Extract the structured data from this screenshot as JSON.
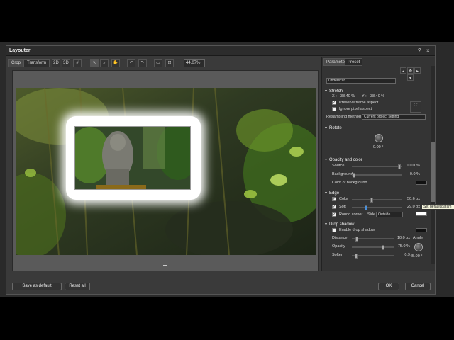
{
  "window": {
    "title": "Layouter",
    "controls": [
      "?",
      "×"
    ]
  },
  "tabs": [
    {
      "label": "Crop"
    },
    {
      "label": "Transform"
    }
  ],
  "toolbar": {
    "buttons": [
      "2D",
      "3D",
      "grid",
      "arrow",
      "zoom",
      "hand",
      "undo",
      "redo",
      "frame",
      "fit"
    ],
    "zoom_value": "44.07%"
  },
  "panel": {
    "tabs": [
      {
        "label": "Parameter"
      },
      {
        "label": "Preset"
      }
    ],
    "scan_select": "Underscan",
    "stretch": {
      "title": "Stretch",
      "x_label": "X :",
      "x_value": "38.40 %",
      "y_label": "Y :",
      "y_value": "38.40 %",
      "preserve_frame": "Preserve frame aspect",
      "ignore_pixel": "Ignore pixel aspect",
      "resampling_label": "Resampling method",
      "resampling_value": "Current project setting"
    },
    "rotate": {
      "title": "Rotate",
      "value": "0.00 °"
    },
    "opacity": {
      "title": "Opacity and color",
      "source_label": "Source",
      "source_value": "100.0%",
      "source_fraction": 1.0,
      "background_label": "Background",
      "background_value": "0.0 %",
      "background_fraction": 0.0,
      "color_bg_label": "Color of background"
    },
    "edge": {
      "title": "Edge",
      "color_label": "Color",
      "color_value": "50.6 px",
      "color_fraction": 0.39,
      "soft_label": "Soft",
      "soft_value": "29.0 px",
      "soft_fraction": 0.26,
      "round_corner": "Round corner",
      "side_label": "Side",
      "side_value": "Outside"
    },
    "drop_shadow": {
      "title": "Drop shadow",
      "enable": "Enable drop shadow",
      "distance_label": "Distance",
      "distance_value": "10.0 px",
      "distance_fraction": 0.08,
      "opacity_label": "Opacity",
      "opacity_value": "75.0 %",
      "opacity_fraction": 0.75,
      "soften_label": "Soften",
      "soften_value": "0.9",
      "soften_fraction": 0.06,
      "angle_label": "Angle",
      "angle_value": "45.00 °"
    }
  },
  "tooltip": "Set default param",
  "footer": {
    "save_default": "Save as default",
    "reset_all": "Reset all",
    "ok": "OK",
    "cancel": "Cancel"
  },
  "colors": {
    "dialog_bg": "#3a3a3a",
    "panel_bg": "#343434",
    "edge_frame": "#ffffff",
    "slider_accent": "#4a90d9"
  }
}
